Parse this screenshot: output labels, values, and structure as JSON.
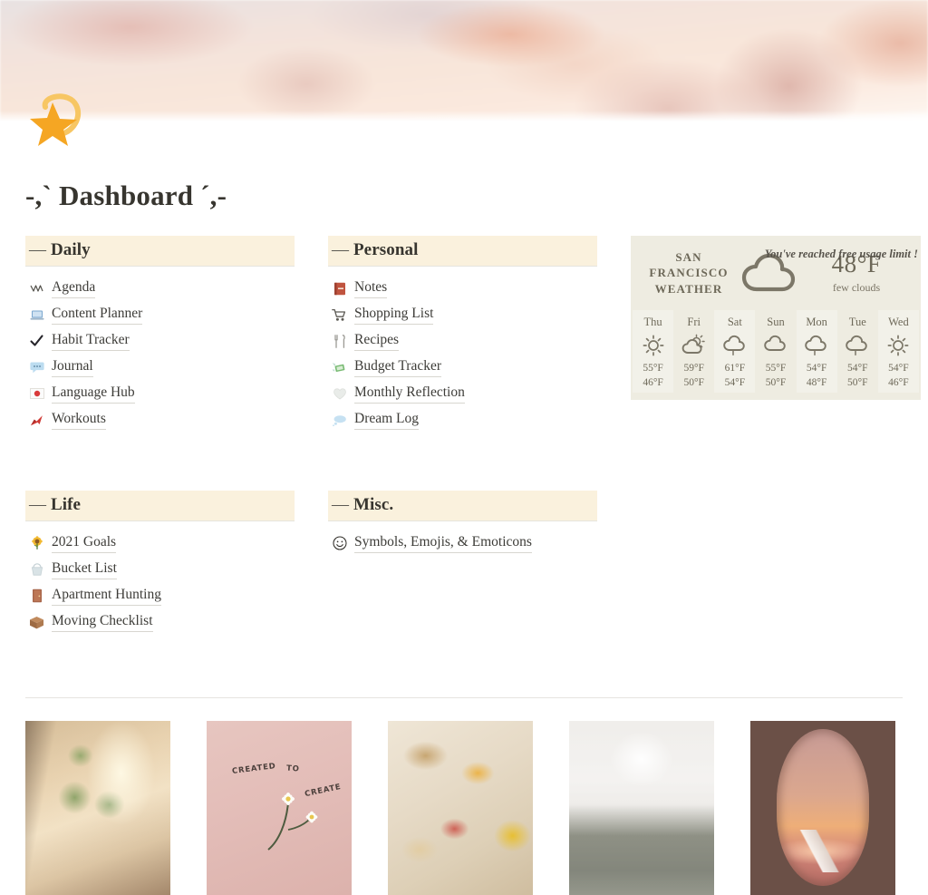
{
  "page": {
    "title": "-,` Dashboard ´,-",
    "icon": "star-with-swirl-icon",
    "cover": "pink-cloud-sky-banner"
  },
  "colors": {
    "section_header_bg": "#faf1dd",
    "text": "#37352f",
    "link_underline": "#d8d6d0",
    "weather_bg": "#eeece1",
    "weather_text": "#6d6858",
    "star_icon": "#f5a623"
  },
  "sections": [
    {
      "key": "daily",
      "dash": "—",
      "title": "Daily",
      "items": [
        {
          "icon": "wave-icon",
          "glyph": "〰",
          "label": "Agenda"
        },
        {
          "icon": "laptop-icon",
          "glyph": "💻",
          "label": "Content Planner"
        },
        {
          "icon": "check-mark-icon",
          "glyph": "✔",
          "label": "Habit Tracker"
        },
        {
          "icon": "speech-balloon-icon",
          "glyph": "💬",
          "label": "Journal"
        },
        {
          "icon": "japan-flag-icon",
          "glyph": "🔴",
          "label": "Language Hub"
        },
        {
          "icon": "boxing-glove-icon",
          "glyph": "🥊",
          "label": "Workouts"
        }
      ]
    },
    {
      "key": "personal",
      "dash": "—",
      "title": "Personal",
      "items": [
        {
          "icon": "closed-book-icon",
          "glyph": "📕",
          "label": "Notes"
        },
        {
          "icon": "shopping-cart-icon",
          "glyph": "🛒",
          "label": "Shopping List"
        },
        {
          "icon": "fork-and-knife-icon",
          "glyph": "🍴",
          "label": "Recipes"
        },
        {
          "icon": "money-with-wings-icon",
          "glyph": "💸",
          "label": "Budget Tracker"
        },
        {
          "icon": "white-heart-icon",
          "glyph": "🤍",
          "label": "Monthly Reflection"
        },
        {
          "icon": "thought-balloon-icon",
          "glyph": "💭",
          "label": "Dream Log"
        }
      ]
    },
    {
      "key": "life",
      "dash": "—",
      "title": "Life",
      "items": [
        {
          "icon": "sunflower-icon",
          "glyph": "🌻",
          "label": "2021 Goals"
        },
        {
          "icon": "bucket-icon",
          "glyph": "🪣",
          "label": "Bucket List"
        },
        {
          "icon": "door-icon",
          "glyph": "🚪",
          "label": "Apartment Hunting"
        },
        {
          "icon": "package-icon",
          "glyph": "📦",
          "label": "Moving Checklist"
        }
      ]
    },
    {
      "key": "misc",
      "dash": "—",
      "title": "Misc.",
      "items": [
        {
          "icon": "smiley-face-icon",
          "glyph": "☺",
          "label": "Symbols, Emojis, & Emoticons"
        }
      ]
    }
  ],
  "weather": {
    "city": "SAN\nFRANCISCO\nWEATHER",
    "city_line1": "SAN",
    "city_line2": "FRANCISCO",
    "city_line3": "WEATHER",
    "notice": "You've reached free usage limit !",
    "current_icon": "cloud-icon",
    "current_temp": "48°F",
    "current_desc": "few clouds",
    "forecast": [
      {
        "day": "Thu",
        "icon": "sun-icon",
        "high": "55°F",
        "low": "46°F"
      },
      {
        "day": "Fri",
        "icon": "sun-behind-cloud-icon",
        "high": "59°F",
        "low": "50°F"
      },
      {
        "day": "Sat",
        "icon": "cloud-rain-icon",
        "high": "61°F",
        "low": "54°F"
      },
      {
        "day": "Sun",
        "icon": "cloud-icon",
        "high": "55°F",
        "low": "50°F"
      },
      {
        "day": "Mon",
        "icon": "cloud-rain-icon",
        "high": "54°F",
        "low": "48°F"
      },
      {
        "day": "Tue",
        "icon": "cloud-rain-icon",
        "high": "54°F",
        "low": "50°F"
      },
      {
        "day": "Wed",
        "icon": "sun-icon",
        "high": "54°F",
        "low": "46°F"
      }
    ]
  },
  "gallery": [
    {
      "name": "cozy-room-photo",
      "alt": "Sunlit room with plant shelves and desk"
    },
    {
      "name": "created-to-create-photo",
      "alt": "Pink wall with daisies",
      "line1": "CREATED",
      "line2": "TO",
      "line3": "CREATE"
    },
    {
      "name": "picnic-photo",
      "alt": "Picnic spread with fruit and drinks"
    },
    {
      "name": "outfit-photo",
      "alt": "White blouse and green trousers outfit"
    },
    {
      "name": "plane-window-photo",
      "alt": "Airplane window sunset view"
    }
  ]
}
